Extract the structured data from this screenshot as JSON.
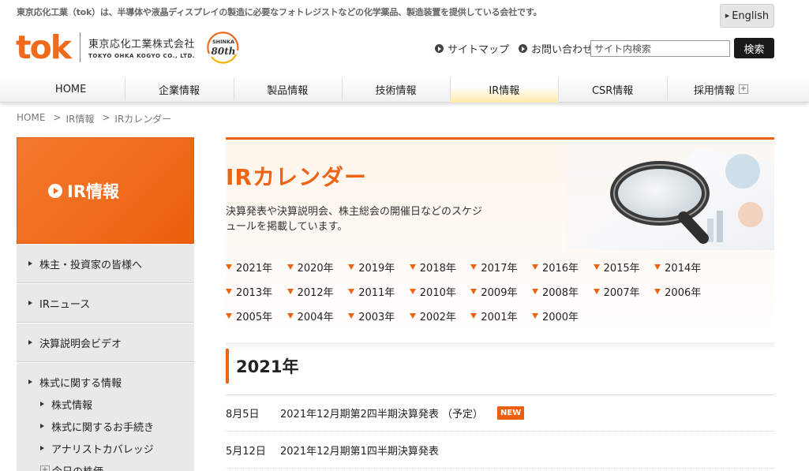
{
  "header": {
    "tagline": "東京応化工業（tok）は、半導体や液晶ディスプレイの製造に必要なフォトレジストなどの化学薬品、製造装置を提供している会社です。",
    "english_label": "English",
    "logo_main": "tok",
    "logo_company_jp": "東京応化工業株式会社",
    "logo_company_en": "TOKYO OHKA KOGYO CO., LTD.",
    "anniversary_top": "SHINKA",
    "anniversary_main": "80th",
    "sitemap_label": "サイトマップ",
    "contact_label": "お問い合わせ",
    "search_placeholder": "サイト内検索",
    "search_button": "検索"
  },
  "global_nav": {
    "items": [
      {
        "label": "HOME"
      },
      {
        "label": "企業情報"
      },
      {
        "label": "製品情報"
      },
      {
        "label": "技術情報"
      },
      {
        "label": "IR情報"
      },
      {
        "label": "CSR情報"
      },
      {
        "label": "採用情報"
      }
    ],
    "active": "IR情報"
  },
  "breadcrumb": {
    "items": [
      "HOME",
      "IR情報",
      "IRカレンダー"
    ],
    "separator": ">"
  },
  "sidebar": {
    "title": "IR情報",
    "items": [
      {
        "label": "株主・投資家の皆様へ"
      },
      {
        "label": "IRニュース"
      },
      {
        "label": "決算説明会ビデオ"
      }
    ],
    "group": {
      "title": "株式に関する情報",
      "subitems": [
        {
          "label": "株式情報"
        },
        {
          "label": "株式に関するお手続き"
        },
        {
          "label": "アナリストカバレッジ"
        },
        {
          "label": "今日の株価"
        }
      ]
    }
  },
  "main": {
    "title": "IRカレンダー",
    "description": "決算発表や決算説明会、株主総会の開催日などのスケジュールを掲載しています。",
    "year_links": [
      "2021年",
      "2020年",
      "2019年",
      "2018年",
      "2017年",
      "2016年",
      "2015年",
      "2014年",
      "2013年",
      "2012年",
      "2011年",
      "2010年",
      "2009年",
      "2008年",
      "2007年",
      "2006年",
      "2005年",
      "2004年",
      "2003年",
      "2002年",
      "2001年",
      "2000年"
    ],
    "section_year": "2021年",
    "events": [
      {
        "date": "8月5日",
        "title": "2021年12月期第2四半期決算発表 （予定）",
        "badge": "NEW"
      },
      {
        "date": "5月12日",
        "title": "2021年12月期第1四半期決算発表",
        "badge": ""
      }
    ]
  },
  "colors": {
    "brand_orange": "#ec6414",
    "nav_active": "#fdeaa8",
    "sidebar_bg": "#e9e9e9"
  }
}
